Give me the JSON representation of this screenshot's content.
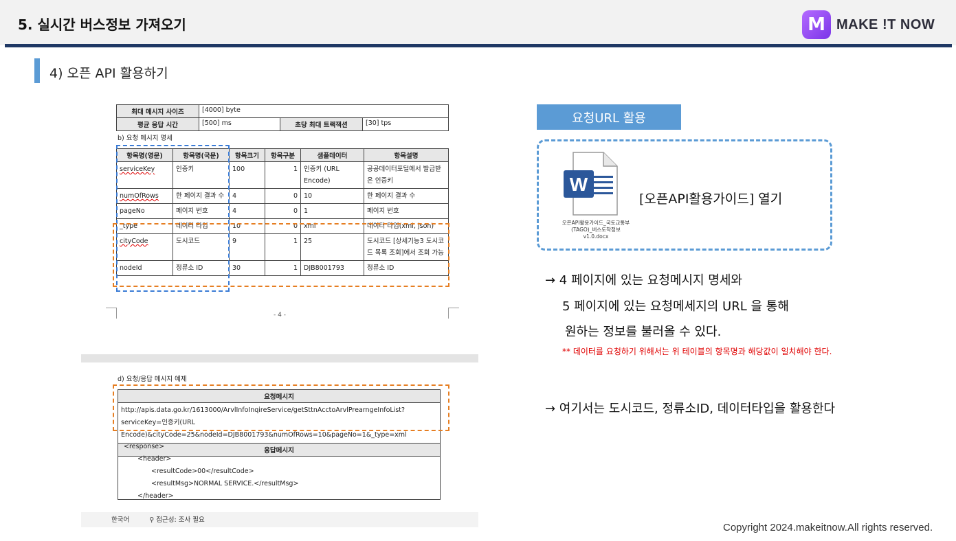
{
  "header": {
    "title": "5. 실시간 버스정보 가져오기",
    "logo_letter": "M",
    "logo_text": "MAKE !T NOW",
    "accent_color": "#1f3864"
  },
  "section": {
    "title": "4) 오픈 API 활용하기"
  },
  "doc": {
    "top_table": {
      "row1_label": "최대 메시지 사이즈",
      "row1_value": "[4000] byte",
      "row2_label": "평균 응답 시간",
      "row2_value": "[500] ms",
      "row2_label2": "초당 최대 트랙잭션",
      "row2_value2": "[30] tps"
    },
    "spec_caption": "b) 요청 메시지 명세",
    "spec_headers": [
      "항목명(영문)",
      "항목명(국문)",
      "항목크기",
      "항목구분",
      "샘플데이터",
      "항목설명"
    ],
    "spec_rows": [
      [
        "serviceKey",
        "인증키",
        "100",
        "1",
        "인증키 (URL Encode)",
        "공공데이터포털에서 발급받은 인증키"
      ],
      [
        "numOfRows",
        "한 페이지 결과 수",
        "4",
        "0",
        "10",
        "한 페이지 결과 수"
      ],
      [
        "pageNo",
        "페이지 번호",
        "4",
        "0",
        "1",
        "페이지 번호"
      ],
      [
        "_type",
        "데이터 타입",
        "10",
        "0",
        "xml",
        "데이터 타입(xml, json)"
      ],
      [
        "cityCode",
        "도시코드",
        "9",
        "1",
        "25",
        "도시코드 [상세기능3 도시코드 목록 조회]에서 조회 가능"
      ],
      [
        "nodeId",
        "정류소 ID",
        "30",
        "1",
        "DJB8001793",
        "정류소 ID"
      ]
    ],
    "page_number": "- 4 -",
    "example_caption": "d) 요청/응답 메시지 예제",
    "request_header": "요청메시지",
    "request_url": "http://apis.data.go.kr/1613000/ArvlInfoInqireService/getSttnAcctoArvlPrearngeInfoList?serviceKey=인증키(URL Encode)&cityCode=25&nodeId=DJB8001793&numOfRows=10&pageNo=1&_type=xml",
    "response_header": "응답메시지",
    "response_lines": [
      "<response>",
      "<header>",
      "<resultCode>00</resultCode>",
      "<resultMsg>NORMAL SERVICE.</resultMsg>",
      "</header>"
    ],
    "status_lang": "한국어",
    "status_access": "접근성: 조사 필요"
  },
  "right": {
    "tag": "요청URL 활용",
    "file_name": "오픈API활용가이드_국토교통부(TAGO)_버스도착정보 v1.0.docx",
    "open_guide": "[오픈API활용가이드] 열기",
    "desc1": "→ 4 페이지에 있는 요청메시지 명세와",
    "desc2": "5 페이지에 있는 요청메세지의 URL 을 통해",
    "desc3": "원하는 정보를 불러올 수 있다.",
    "note": "** 데이터를 요청하기 위해서는 위 테이블의 항목명과 해당값이 일치해야 한다.",
    "desc4": "→ 여기서는 도시코드, 정류소ID, 데이터타입을 활용한다"
  },
  "footer": {
    "copyright": "Copyright 2024.makeitnow.All rights reserved."
  }
}
